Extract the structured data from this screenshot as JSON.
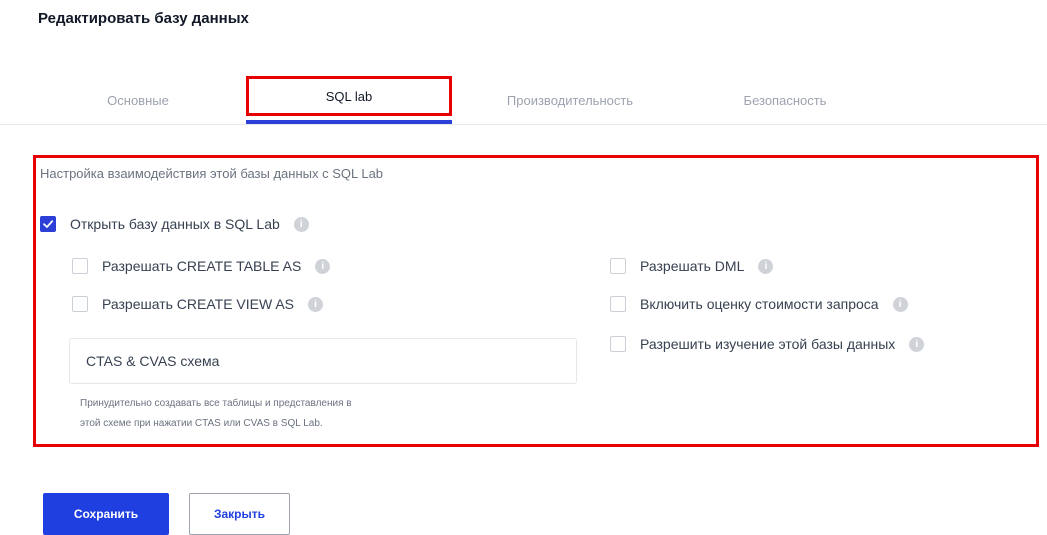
{
  "page": {
    "title": "Редактировать базу данных"
  },
  "tabs": [
    {
      "label": "Основные",
      "active": false
    },
    {
      "label": "SQL lab",
      "active": true
    },
    {
      "label": "Производительность",
      "active": false
    },
    {
      "label": "Безопасность",
      "active": false
    }
  ],
  "panel": {
    "description": "Настройка взаимодействия этой базы данных с SQL Lab",
    "main_checkbox": {
      "label": "Открыть базу данных в SQL Lab",
      "checked": true
    },
    "left_checkboxes": [
      {
        "label": "Разрешать CREATE TABLE AS",
        "checked": false
      },
      {
        "label": "Разрешать CREATE VIEW AS",
        "checked": false
      }
    ],
    "right_checkboxes": [
      {
        "label": "Разрешать DML",
        "checked": false
      },
      {
        "label": "Включить оценку стоимости запроса",
        "checked": false
      },
      {
        "label": "Разрешить изучение этой базы данных",
        "checked": false
      }
    ],
    "schema_input": {
      "value": "CTAS & CVAS схема",
      "placeholder": "CTAS & CVAS схема"
    },
    "helper_text_line1": "Принудительно создавать все таблицы и представления в",
    "helper_text_line2": "этой схеме при нажатии CTAS или CVAS в SQL Lab."
  },
  "buttons": {
    "save": "Сохранить",
    "close": "Закрыть"
  },
  "colors": {
    "accent": "#1f3fe0",
    "highlight": "#e60000"
  },
  "icons": {
    "info": "info-icon",
    "check": "checkmark-icon"
  }
}
